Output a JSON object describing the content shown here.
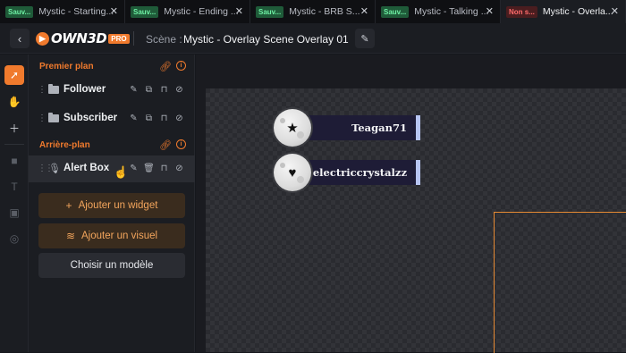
{
  "tabs": [
    {
      "badge": "Sauv...",
      "badge_type": "saved",
      "title": "Mystic - Starting...",
      "active": false
    },
    {
      "badge": "Sauv...",
      "badge_type": "saved",
      "title": "Mystic - Ending ...",
      "active": false
    },
    {
      "badge": "Sauv...",
      "badge_type": "saved",
      "title": "Mystic - BRB S...",
      "active": false
    },
    {
      "badge": "Sauv...",
      "badge_type": "saved",
      "title": "Mystic - Talking ...",
      "active": false
    },
    {
      "badge": "Non s...",
      "badge_type": "unsaved",
      "title": "Mystic - Overla...",
      "active": true
    }
  ],
  "header": {
    "logo_text": "OWN3D",
    "logo_pro": "PRO",
    "scene_label": "Scène :",
    "scene_name": "Mystic - Overlay Scene Overlay 01"
  },
  "panel": {
    "foreground_title": "Premier plan",
    "foreground_layers": [
      {
        "name": "Follower"
      },
      {
        "name": "Subscriber"
      }
    ],
    "background_title": "Arrière-plan",
    "background_layers": [
      {
        "name": "Alert Box"
      }
    ],
    "buttons": {
      "add_widget": "Ajouter un widget",
      "add_visual": "Ajouter un visuel",
      "choose_template": "Choisir un modèle"
    }
  },
  "canvas": {
    "alerts": [
      {
        "name": "Teagan71",
        "icon": "star-icon"
      },
      {
        "name": "electriccrystalzz",
        "icon": "heart-icon"
      }
    ]
  },
  "colors": {
    "accent": "#f07a2d",
    "saved_badge": "#6ef0a4",
    "unsaved_badge": "#ff6b6b",
    "alert_bar": "#1e1c36",
    "alert_edge": "#b7c5f2"
  }
}
